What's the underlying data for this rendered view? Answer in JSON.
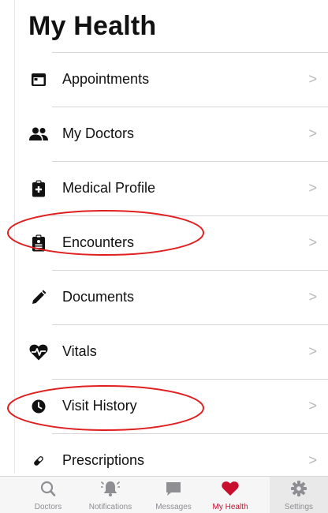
{
  "header": {
    "title": "My Health"
  },
  "menu": {
    "items": [
      {
        "label": "Appointments",
        "icon": "calendar-icon",
        "chevron": ">"
      },
      {
        "label": "My Doctors",
        "icon": "people-icon",
        "chevron": ">"
      },
      {
        "label": "Medical Profile",
        "icon": "medical-clipboard-icon",
        "chevron": ">"
      },
      {
        "label": "Encounters",
        "icon": "encounters-clipboard-icon",
        "chevron": ">",
        "annotated": true
      },
      {
        "label": "Documents",
        "icon": "pencil-icon",
        "chevron": ">"
      },
      {
        "label": "Vitals",
        "icon": "heart-pulse-icon",
        "chevron": ">"
      },
      {
        "label": "Visit History",
        "icon": "clock-icon",
        "chevron": ">",
        "annotated": true
      },
      {
        "label": "Prescriptions",
        "icon": "pill-icon",
        "chevron": ">"
      }
    ]
  },
  "tabbar": {
    "tabs": [
      {
        "label": "Doctors",
        "icon": "search-icon"
      },
      {
        "label": "Notifications",
        "icon": "bell-icon"
      },
      {
        "label": "Messages",
        "icon": "message-icon"
      },
      {
        "label": "My Health",
        "icon": "heart-icon",
        "active": true
      },
      {
        "label": "Settings",
        "icon": "gear-icon",
        "selected": true
      }
    ]
  },
  "colors": {
    "accent": "#c8102e",
    "annotation": "#e02020",
    "inactive": "#8e8e93",
    "chevron": "#b8b8bd"
  }
}
